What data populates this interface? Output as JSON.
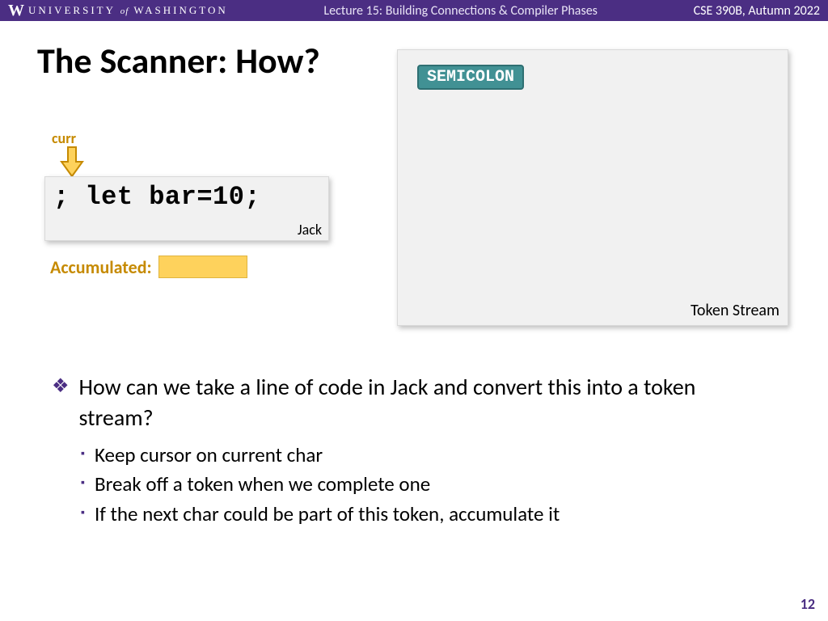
{
  "header": {
    "university_prefix": "UNIVERSITY",
    "university_of": "of",
    "university_suffix": "WASHINGTON",
    "lecture": "Lecture 15: Building Connections & Compiler Phases",
    "course": "CSE 390B, Autumn 2022"
  },
  "slide": {
    "title": "The Scanner: How?",
    "curr_label": "curr",
    "code_line": "; let bar=10;",
    "code_caption": "Jack",
    "accumulated_label": "Accumulated:",
    "accumulated_value": "",
    "token_chip": "SEMICOLON",
    "token_panel_caption": "Token Stream",
    "main_bullet": "How can we take a line of code in Jack and convert this into a token stream?",
    "sub_bullets": [
      "Keep cursor on current char",
      "Break off a token when we complete one",
      "If the next char could be part of this token, accumulate it"
    ],
    "page_number": "12"
  }
}
